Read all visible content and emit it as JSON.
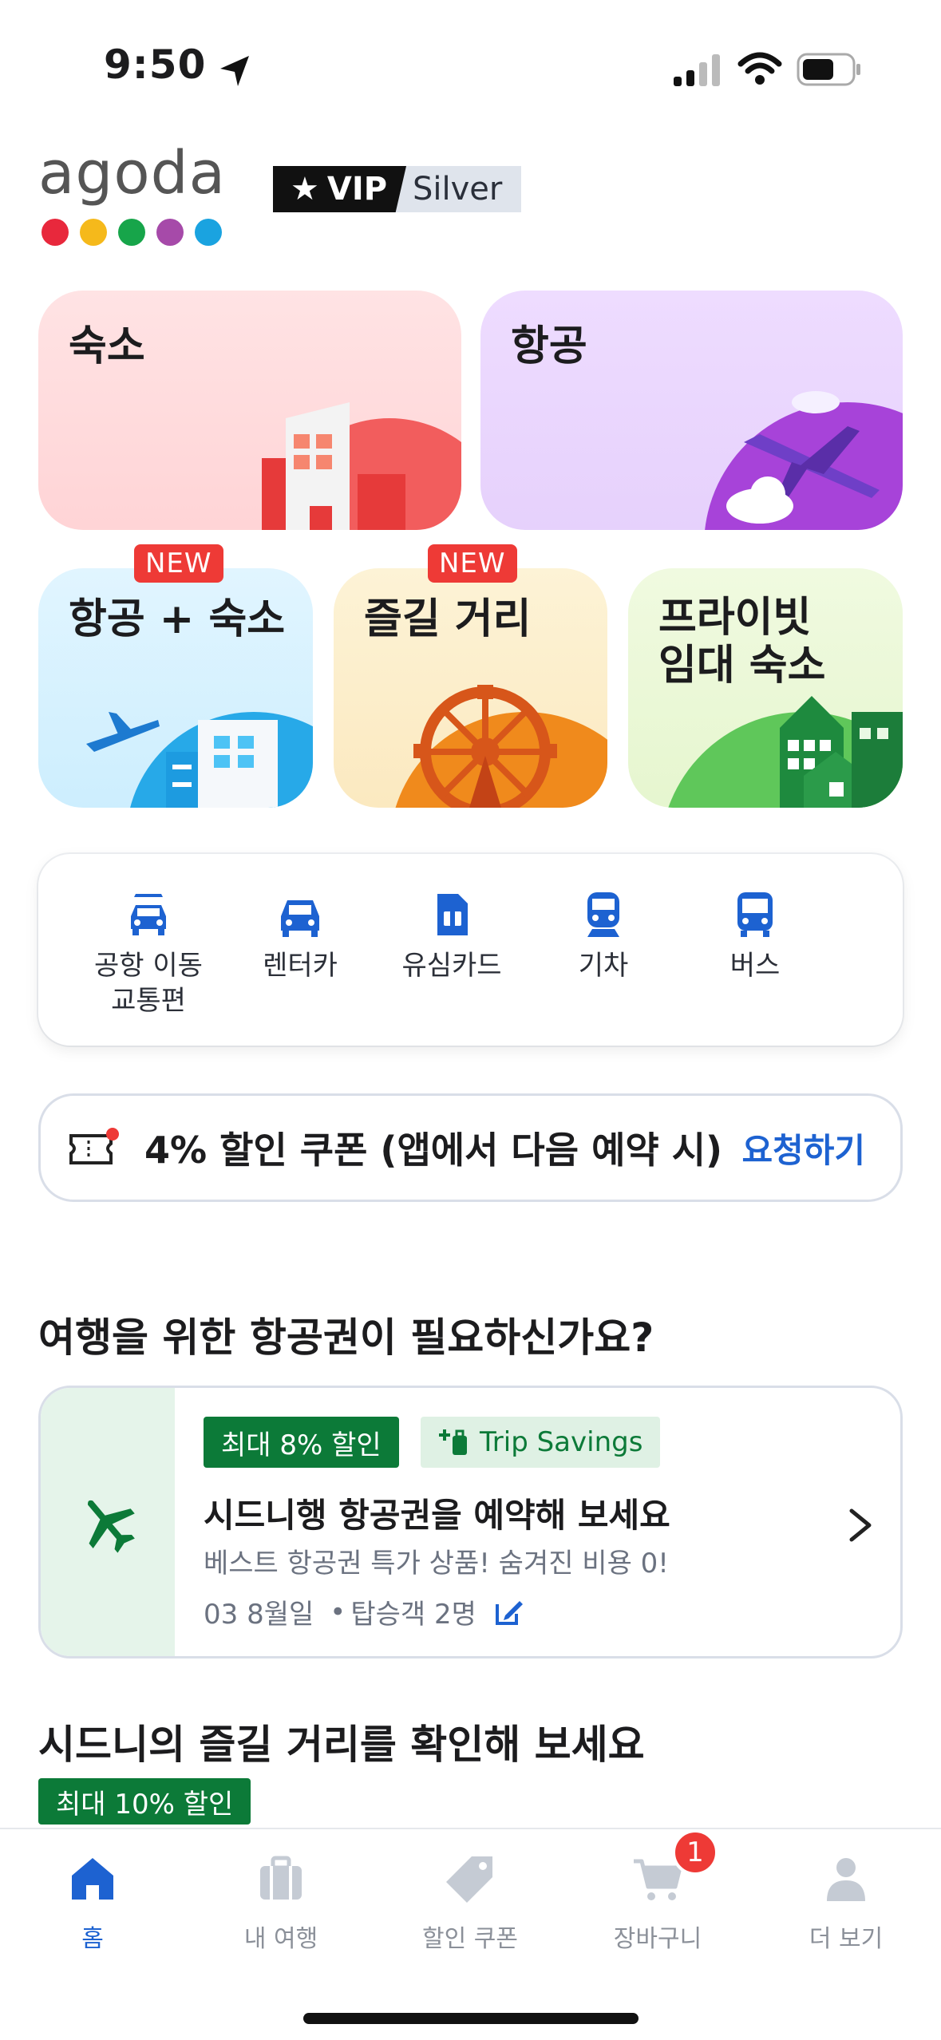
{
  "status_bar": {
    "time": "9:50"
  },
  "header": {
    "logo": "agoda",
    "vip_label": "VIP",
    "vip_tier": "Silver",
    "logo_colors": [
      "#e8283c",
      "#f5b91b",
      "#17a54a",
      "#a64aa9",
      "#1aa3e0"
    ]
  },
  "tiles": {
    "stays": "숙소",
    "flights": "항공",
    "flight_hotel": "항공 + 숙소",
    "activities": "즐길 거리",
    "private_stays_line1": "프라이빗",
    "private_stays_line2": "임대 숙소",
    "new_badge": "NEW"
  },
  "services": [
    {
      "line1": "공항 이동",
      "line2": "교통편"
    },
    {
      "line1": "렌터카",
      "line2": ""
    },
    {
      "line1": "유심카드",
      "line2": ""
    },
    {
      "line1": "기차",
      "line2": ""
    },
    {
      "line1": "버스",
      "line2": ""
    }
  ],
  "coupon": {
    "text": "4% 할인 쿠폰 (앱에서 다음 예약 시)",
    "action": "요청하기"
  },
  "flights_section": {
    "title": "여행을 위한 항공권이 필요하신가요?",
    "discount": "최대 8% 할인",
    "trip_savings": "Trip Savings",
    "headline": "시드니행 항공권을 예약해 보세요",
    "subtext": "베스트 항공권 특가 상품! 숨겨진 비용 0!",
    "date": "03 8월일",
    "passengers": "탑승객 2명"
  },
  "activities_section": {
    "title": "시드니의 즐길 거리를 확인해 보세요",
    "discount": "최대 10% 할인"
  },
  "tab_bar": {
    "home": "홈",
    "my_trips": "내 여행",
    "coupons": "할인 쿠폰",
    "cart": "장바구니",
    "more": "더 보기",
    "cart_count": "1"
  },
  "colors": {
    "accent": "#1d62d1",
    "green": "#0c7a38",
    "badge_red": "#ee3a36"
  }
}
